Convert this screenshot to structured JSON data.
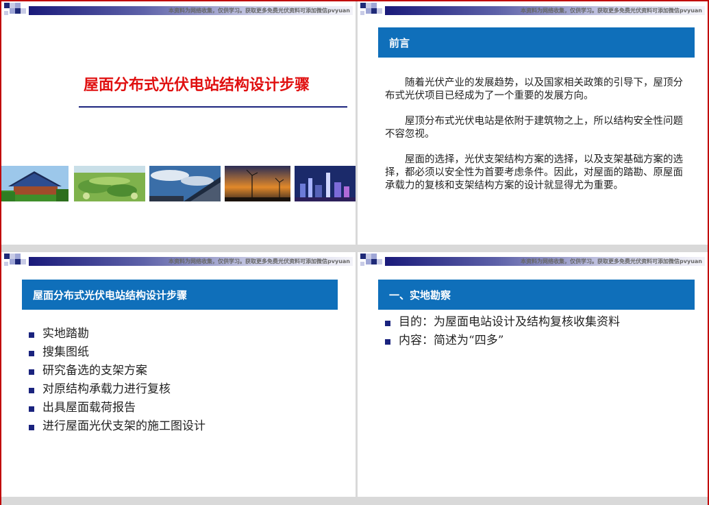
{
  "header_notice": "本资料为网络收集，仅供学习。获取更多免费光伏资料可添加微信pvyuan",
  "slide1": {
    "title": "屋面分布式光伏电站结构设计步骤",
    "photos": [
      "rooftop-solar-house",
      "solar-field-aerial",
      "solar-panels-sky",
      "wind-turbines-sunset",
      "city-skyline-night"
    ]
  },
  "slide2": {
    "header": "前言",
    "paragraphs": [
      "随着光伏产业的发展趋势，以及国家相关政策的引导下，屋顶分布式光伏项目已经成为了一个重要的发展方向。",
      "屋顶分布式光伏电站是依附于建筑物之上，所以结构安全性问题不容忽视。",
      "屋面的选择，光伏支架结构方案的选择，以及支架基础方案的选择，都必须以安全性为首要考虑条件。因此，对屋面的踏勘、原屋面承载力的复核和支架结构方案的设计就显得尤为重要。"
    ]
  },
  "slide3": {
    "header": "屋面分布式光伏电站结构设计步骤",
    "items": [
      "实地踏勘",
      "搜集图纸",
      "研究备选的支架方案",
      "对原结构承载力进行复核",
      "出具屋面载荷报告",
      "进行屋面光伏支架的施工图设计"
    ]
  },
  "slide4": {
    "header": "一、实地勘察",
    "items": [
      "目的：为屋面电站设计及结构复核收集资料",
      "内容：简述为“四多”"
    ]
  },
  "colors": {
    "accent_blue": "#0f6fba",
    "title_red": "#e01010",
    "bullet_navy": "#1a237e",
    "frame_red": "#c00000"
  }
}
